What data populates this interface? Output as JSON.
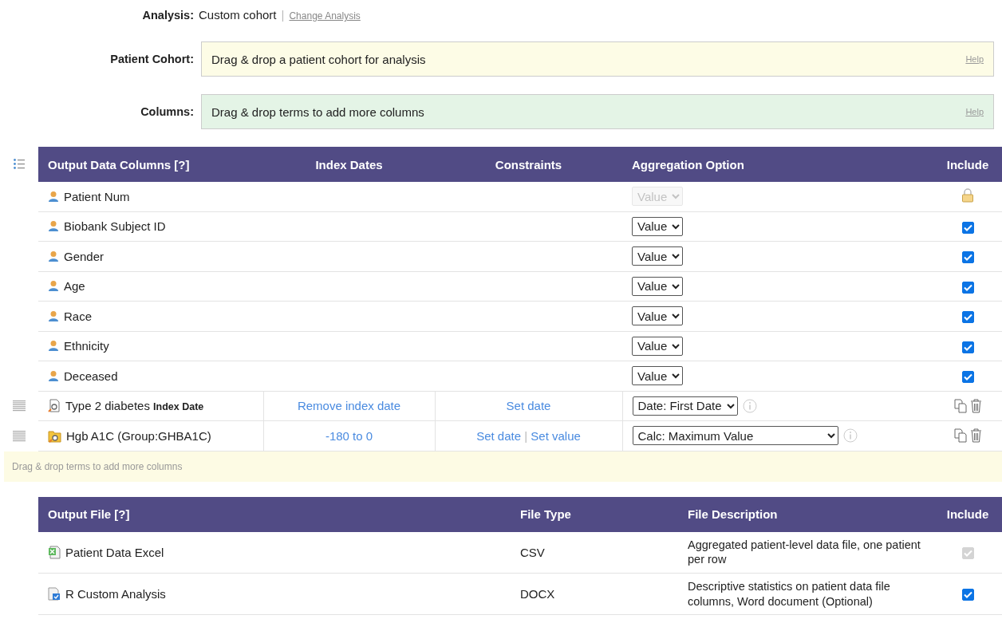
{
  "analysis": {
    "label": "Analysis:",
    "value": "Custom cohort",
    "separator": "|",
    "link": "Change Analysis"
  },
  "drop_zones": [
    {
      "kind": "cohort",
      "label": "Patient Cohort:",
      "text": "Drag & drop a patient cohort for analysis",
      "help": "Help"
    },
    {
      "kind": "columns",
      "label": "Columns:",
      "text": "Drag & drop terms to add more columns",
      "help": "Help"
    }
  ],
  "output_columns": {
    "columns": [
      "Output Data Columns [?]",
      "Index Dates",
      "Constraints",
      "Aggregation Option",
      "Include"
    ],
    "rows": [
      {
        "kind": "demographic",
        "name": "Patient Num",
        "aggregation": "Value",
        "aggregation_disabled": true,
        "locked": true
      },
      {
        "kind": "demographic",
        "name": "Biobank Subject ID",
        "aggregation": "Value",
        "aggregation_disabled": false,
        "checked": true
      },
      {
        "kind": "demographic",
        "name": "Gender",
        "aggregation": "Value",
        "aggregation_disabled": false,
        "checked": true
      },
      {
        "kind": "demographic",
        "name": "Age",
        "aggregation": "Value",
        "aggregation_disabled": false,
        "checked": true
      },
      {
        "kind": "demographic",
        "name": "Race",
        "aggregation": "Value",
        "aggregation_disabled": false,
        "checked": true
      },
      {
        "kind": "demographic",
        "name": "Ethnicity",
        "aggregation": "Value",
        "aggregation_disabled": false,
        "checked": true
      },
      {
        "kind": "demographic",
        "name": "Deceased",
        "aggregation": "Value",
        "aggregation_disabled": false,
        "checked": true
      },
      {
        "kind": "term",
        "name": "Type 2 diabetes **Index Date**",
        "index_dates": "Remove index date",
        "constraints": [
          "Set date"
        ],
        "aggregation": "Date: First Date",
        "aggregation_disabled": false
      },
      {
        "kind": "group",
        "name": "Hgb A1C (Group:GHBA1C)",
        "index_dates": "-180 to 0",
        "constraints": [
          "Set date",
          "Set value"
        ],
        "constraint_separator": "|",
        "aggregation": "Calc: Maximum Value",
        "aggregation_disabled": false
      }
    ],
    "drop_hint": "Drag & drop terms to add more columns"
  },
  "output_files": {
    "columns": [
      "Output File [?]",
      "File Type",
      "File Description",
      "Include"
    ],
    "rows": [
      {
        "kind": "spreadsheet",
        "name": "Patient Data Excel",
        "file_type": "CSV",
        "description": "Aggregated patient-level data file, one patient per row",
        "checked": true,
        "disabled": true
      },
      {
        "kind": "document",
        "name": "R Custom Analysis",
        "file_type": "DOCX",
        "description": "Descriptive statistics on patient data file columns, Word document (Optional)",
        "checked": true,
        "disabled": false
      }
    ]
  }
}
